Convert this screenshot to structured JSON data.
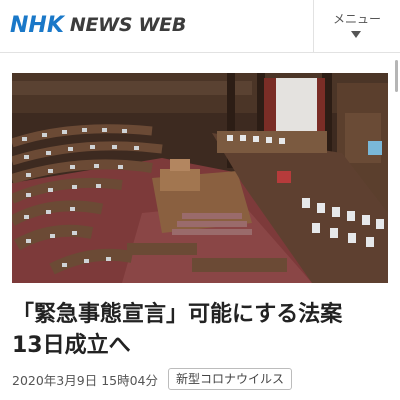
{
  "header": {
    "logo_primary": "NHK",
    "logo_secondary": "NEWS WEB",
    "menu_label": "メニュー",
    "menu_icon": "chevron-down-icon"
  },
  "article": {
    "image_subject": "parliament chamber photo",
    "headline_line1": "「緊急事態宣言」可能にする法案",
    "headline_line2": "13日成立へ",
    "date": "2020年3月9日 15時04分",
    "tag": "新型コロナウイルス"
  },
  "colors": {
    "logo_blue": "#1a78c8",
    "text": "#222222"
  }
}
